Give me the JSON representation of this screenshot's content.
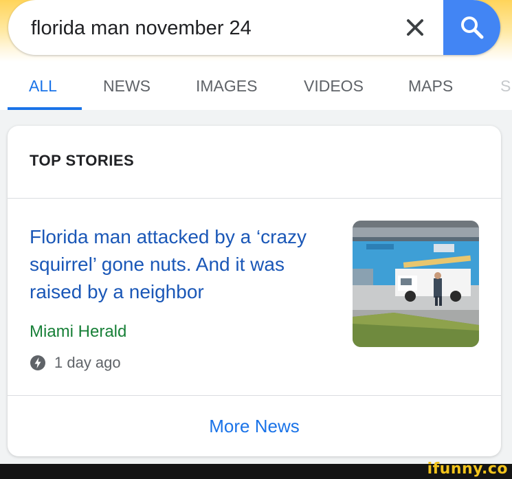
{
  "search": {
    "query": "florida man november 24",
    "clear_icon": "close-icon",
    "search_icon": "magnifier-icon",
    "accent_color": "#4285f4"
  },
  "tabs": [
    {
      "label": "ALL",
      "active": true
    },
    {
      "label": "NEWS",
      "active": false
    },
    {
      "label": "IMAGES",
      "active": false
    },
    {
      "label": "VIDEOS",
      "active": false
    },
    {
      "label": "MAPS",
      "active": false
    },
    {
      "label": "S",
      "active": false
    }
  ],
  "top_stories": {
    "heading": "TOP STORIES",
    "story": {
      "title": "Florida man attacked by a ‘crazy squirrel’ gone nuts. And it was raised by a neighbor",
      "source": "Miami Herald",
      "time": "1 day ago",
      "time_icon": "amp-bolt-icon",
      "thumbnail_icon": "news-thumbnail-photo"
    },
    "more_label": "More News"
  },
  "watermark": {
    "text": "ifunny.co",
    "color": "#f2c31b"
  },
  "colors": {
    "link_blue": "#1a57b7",
    "source_green": "#188038",
    "tab_active": "#1a73e8"
  }
}
